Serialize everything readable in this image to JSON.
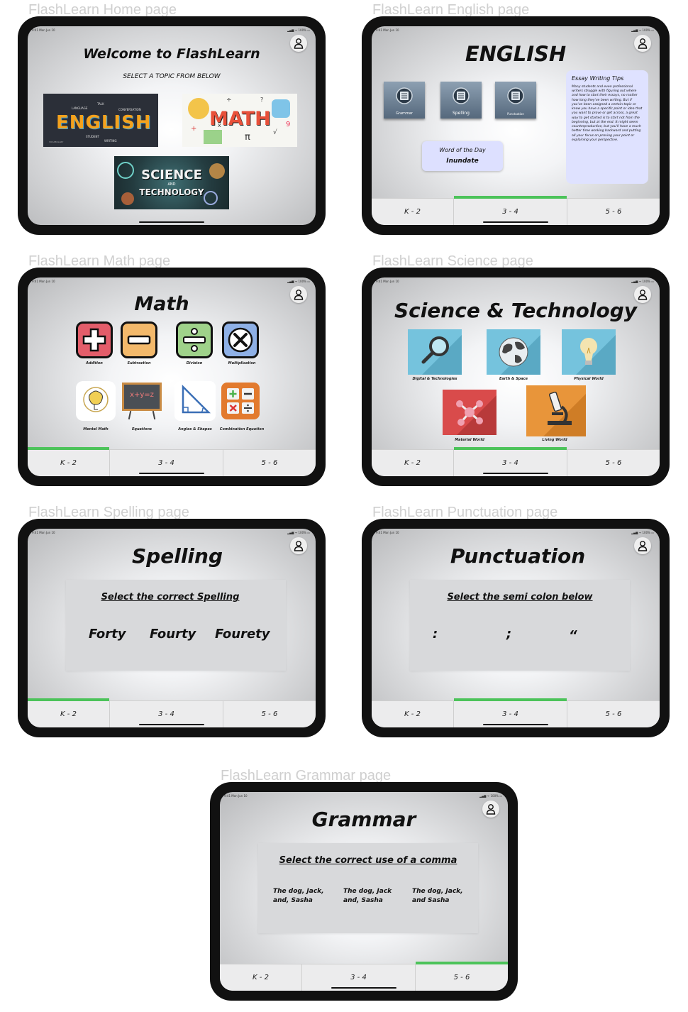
{
  "status_time": "9:41  Mon Jun 10",
  "status_sys": "▂▄▆ ᯤ 100% ▭",
  "tabs": [
    "K - 2",
    "3 - 4",
    "5 - 6"
  ],
  "frames": {
    "home": {
      "label": "FlashLearn Home page",
      "title": "Welcome to FlashLearn",
      "subtitle": "SELECT A TOPIC FROM BELOW",
      "banners": {
        "english": {
          "text": "ENGLISH",
          "words": [
            "LANGUAGE",
            "TALK",
            "CONVERSATION",
            "STUDENT",
            "WRITING",
            "VOCABULARY"
          ]
        },
        "math": {
          "text": "MATH",
          "doodles": [
            "+",
            "÷",
            "π",
            "√",
            "9",
            "x",
            "?"
          ]
        },
        "science": {
          "line1": "SCIENCE",
          "line2": "AND",
          "line3": "TECHNOLOGY"
        }
      }
    },
    "english": {
      "label": "FlashLearn English page",
      "title": "ENGLISH",
      "buttons": [
        "Grammar",
        "Spelling",
        "Punctuation"
      ],
      "word_of_day_label": "Word of the Day",
      "word_of_day": "Inundate",
      "tips_title": "Essay Writing Tips",
      "tips_body": "Many students and even professional writers struggle with figuring out where and how to start their essays, no matter how long they've been writing. But if you've been assigned a certain topic or know you have a specific point or idea that you want to prove or get across, a great way to get started is to start not from the beginning, but at the end. It might seem counterproductive, but you'll have a much better time working backward and putting all your focus on proving your point or explaining your perspective.",
      "active_tab": 1
    },
    "math": {
      "label": "FlashLearn Math page",
      "title": "Math",
      "operations": [
        "Addition",
        "Subtraction",
        "Division",
        "Multiplication"
      ],
      "topics": [
        "Mental Math",
        "Equations",
        "Angles & Shapes",
        "Combination Equation"
      ],
      "equation_text": "x+y=z",
      "active_tab": 0
    },
    "science": {
      "label": "FlashLearn Science page",
      "title": "Science & Technology",
      "topics": [
        "Digital & Technologies",
        "Earth & Space",
        "Physical World",
        "Material World",
        "Living World"
      ],
      "active_tab": 1
    },
    "spelling": {
      "label": "FlashLearn Spelling page",
      "title": "Spelling",
      "question": "Select the correct Spelling",
      "options": [
        "Forty",
        "Fourty",
        "Fourety"
      ],
      "active_tab": 0
    },
    "punctuation": {
      "label": "FlashLearn Punctuation page",
      "title": "Punctuation",
      "question": "Select the semi colon below",
      "options": [
        ":",
        ";",
        "“"
      ],
      "active_tab": 1
    },
    "grammar": {
      "label": "FlashLearn Grammar page",
      "title": "Grammar",
      "question": "Select the correct use of a comma",
      "options": [
        "The dog, Jack, and, Sasha",
        "The dog, Jack and, Sasha",
        "The dog, Jack, and Sasha"
      ],
      "active_tab": 2
    }
  }
}
